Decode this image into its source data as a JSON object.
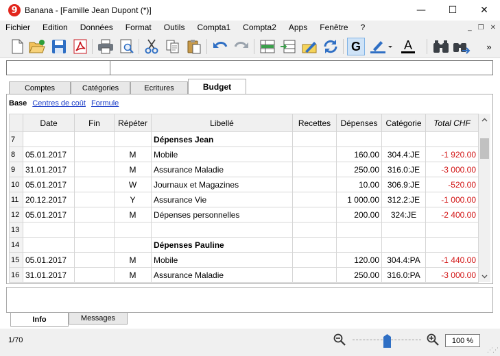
{
  "window": {
    "app_icon_glyph": "9",
    "title": "Banana - [Famille Jean Dupont (*)]",
    "minimize_glyph": "—",
    "maximize_glyph": "☐",
    "close_glyph": "✕"
  },
  "menu": {
    "items": [
      "Fichier",
      "Edition",
      "Données",
      "Format",
      "Outils",
      "Compta1",
      "Compta2",
      "Apps",
      "Fenêtre",
      "?"
    ],
    "mdi_minimize": "_",
    "mdi_restore": "❐",
    "mdi_close": "✕"
  },
  "toolbar": {
    "bold_label": "G",
    "font_color_label": "A",
    "overflow_glyph": "»",
    "icons": [
      "new-document-icon",
      "open-folder-icon",
      "save-icon",
      "pdf-icon",
      "print-icon",
      "print-preview-icon",
      "cut-icon",
      "copy-icon",
      "paste-icon",
      "undo-icon",
      "redo-icon",
      "add-rows-icon",
      "insert-rows-icon",
      "edit-pencil-icon",
      "recalculate-icon",
      "bold-icon",
      "highlight-icon",
      "font-color-icon",
      "find-icon",
      "find-next-icon",
      "overflow-icon"
    ]
  },
  "tabs": [
    "Comptes",
    "Catégories",
    "Ecritures",
    "Budget"
  ],
  "active_tab": "Budget",
  "views": {
    "current": "Base",
    "links": [
      "Centres de coût",
      "Formule"
    ]
  },
  "columns": [
    "Date",
    "Fin",
    "Répéter",
    "Libellé",
    "Recettes",
    "Dépenses",
    "Catégorie",
    "Total CHF"
  ],
  "rows": [
    {
      "num": "7",
      "date": "",
      "fin": "",
      "repeter": "",
      "libelle": "Dépenses Jean",
      "recettes": "",
      "depenses": "",
      "categorie": "",
      "total": "",
      "header": true
    },
    {
      "num": "8",
      "date": "05.01.2017",
      "fin": "",
      "repeter": "M",
      "libelle": "Mobile",
      "recettes": "",
      "depenses": "160.00",
      "categorie": "304.4:JE",
      "total": "-1 920.00"
    },
    {
      "num": "9",
      "date": "31.01.2017",
      "fin": "",
      "repeter": "M",
      "libelle": "Assurance Maladie",
      "recettes": "",
      "depenses": "250.00",
      "categorie": "316.0:JE",
      "total": "-3 000.00"
    },
    {
      "num": "10",
      "date": "05.01.2017",
      "fin": "",
      "repeter": "W",
      "libelle": "Journaux et Magazines",
      "recettes": "",
      "depenses": "10.00",
      "categorie": "306.9:JE",
      "total": "-520.00"
    },
    {
      "num": "11",
      "date": "20.12.2017",
      "fin": "",
      "repeter": "Y",
      "libelle": "Assurance Vie",
      "recettes": "",
      "depenses": "1 000.00",
      "categorie": "312.2:JE",
      "total": "-1 000.00"
    },
    {
      "num": "12",
      "date": "05.01.2017",
      "fin": "",
      "repeter": "M",
      "libelle": "Dépenses personnelles",
      "recettes": "",
      "depenses": "200.00",
      "categorie": "324:JE",
      "total": "-2 400.00"
    },
    {
      "num": "13",
      "date": "",
      "fin": "",
      "repeter": "",
      "libelle": "",
      "recettes": "",
      "depenses": "",
      "categorie": "",
      "total": ""
    },
    {
      "num": "14",
      "date": "",
      "fin": "",
      "repeter": "",
      "libelle": "Dépenses Pauline",
      "recettes": "",
      "depenses": "",
      "categorie": "",
      "total": "",
      "header": true
    },
    {
      "num": "15",
      "date": "05.01.2017",
      "fin": "",
      "repeter": "M",
      "libelle": "Mobile",
      "recettes": "",
      "depenses": "120.00",
      "categorie": "304.4:PA",
      "total": "-1 440.00"
    },
    {
      "num": "16",
      "date": "31.01.2017",
      "fin": "",
      "repeter": "M",
      "libelle": "Assurance Maladie",
      "recettes": "",
      "depenses": "250.00",
      "categorie": "316.0:PA",
      "total": "-3 000.00"
    }
  ],
  "bottom_tabs": [
    "Info",
    "Messages"
  ],
  "active_bottom_tab": "Info",
  "status": {
    "position": "1/70",
    "zoom": "100 %",
    "zoom_level_percent": 100
  },
  "colors": {
    "negative": "#d21414",
    "link": "#1a3cc8",
    "accent_blue": "#2f6fc4"
  }
}
